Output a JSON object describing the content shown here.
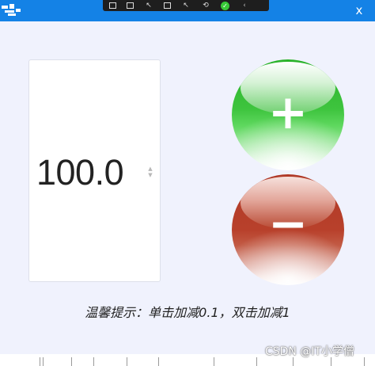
{
  "window": {
    "close_label": "x",
    "accent_color": "#1482e6",
    "app_icon": "app-logo-icon"
  },
  "dev_toolbar": {
    "icons": [
      "select-element-icon",
      "video-icon",
      "pointer-icon",
      "window-icon",
      "cursor-icon",
      "hot-reload-icon",
      "check-icon",
      "chevron-left-icon"
    ]
  },
  "number_box": {
    "value": "100.0",
    "spin_up": "▲",
    "spin_down": "▼"
  },
  "buttons": {
    "increment_label": "+",
    "decrement_label": "−",
    "increment_color": "#3ec43e",
    "decrement_color": "#b8402b"
  },
  "tip": {
    "text": "温馨提示：单击加减0.1，双击加减1"
  },
  "watermark": {
    "text": "CSDN @IT小学僧"
  }
}
